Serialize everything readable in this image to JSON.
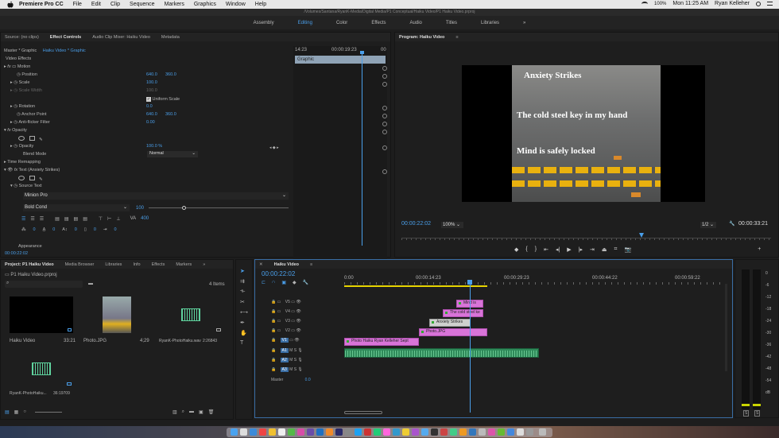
{
  "menubar": {
    "app": "Premiere Pro CC",
    "items": [
      "File",
      "Edit",
      "Clip",
      "Sequence",
      "Markers",
      "Graphics",
      "Window",
      "Help"
    ],
    "time": "Mon 11:25 AM",
    "user": "Ryan Kelleher",
    "battery": "100%"
  },
  "titlebar": {
    "path": "/Volumes/Santana/RyanK-Media/Digital Media/P1 Conceptual/Haiku Video/P1 Haiku Video.prproj"
  },
  "workspaces": {
    "items": [
      "Assembly",
      "Editing",
      "Color",
      "Effects",
      "Audio",
      "Titles",
      "Libraries"
    ],
    "active": "Editing",
    "more": "»"
  },
  "effect_controls": {
    "tabs": [
      "Source: (no clips)",
      "Effect Controls",
      "Audio Clip Mixer: Haiku Video",
      "Metadata"
    ],
    "active_tab": "Effect Controls",
    "clip_label": "Master * Graphic",
    "clip_target": "Haiku Video * Graphic",
    "section": "Video Effects",
    "mini_time_start": "14:23",
    "mini_time_mid": "00:00:19:23",
    "mini_time_end": "00",
    "graphic_label": "Graphic",
    "motion": "Motion",
    "position": "Position",
    "pos_x": "640.0",
    "pos_y": "360.0",
    "scale": "Scale",
    "scale_val": "100.0",
    "scale_width": "Scale Width",
    "scale_width_val": "100.0",
    "uniform_scale": "Uniform Scale",
    "rotation": "Rotation",
    "rotation_val": "0.0",
    "anchor": "Anchor Point",
    "anchor_x": "640.0",
    "anchor_y": "360.0",
    "flicker": "Anti-flicker Filter",
    "flicker_val": "0.00",
    "opacity_section": "Opacity",
    "opacity": "Opacity",
    "opacity_val": "100.0 %",
    "blend": "Blend Mode",
    "blend_val": "Normal",
    "time_remap": "Time Remapping",
    "text_layer": "Text (Anxiety Strikes)",
    "source_text": "Source Text",
    "font": "Minion Pro",
    "style": "Bold Cond",
    "size": "100",
    "tracking_val": "400",
    "zero1": "0",
    "zero2": "0",
    "zero3": "0",
    "zero4": "0",
    "zero5": "0",
    "appearance": "Appearance",
    "timecode": "00:00:22:02"
  },
  "program": {
    "title": "Program: Haiku Video",
    "lines": [
      "Anxiety Strikes",
      "The cold steel key in my hand",
      "Mind is safely locked"
    ],
    "timecode": "00:00:22:02",
    "zoom": "100%",
    "quality": "1/2",
    "duration": "00:00:33:21"
  },
  "project": {
    "tabs": [
      "Project: P1 Haiku Video",
      "Media Browser",
      "Libraries",
      "Info",
      "Effects",
      "Markers"
    ],
    "file": "P1 Haiku Video.prproj",
    "count": "4 Items",
    "items": [
      {
        "name": "Haiku Video",
        "dur": "33:21"
      },
      {
        "name": "Photo.JPG",
        "dur": "4;29"
      },
      {
        "name": "RyanK-PhotoHaiku.wav",
        "dur": "2:26843"
      },
      {
        "name": "RyanK-PhotoHaiku...",
        "dur": "36:19709"
      }
    ]
  },
  "timeline": {
    "title": "Haiku Video",
    "timecode": "00:00:22:02",
    "ruler": [
      "0:00",
      "00:00:14:23",
      "00:00:29:23",
      "00:00:44:22",
      "00:00:59:22"
    ],
    "tracks": [
      "V5",
      "V4",
      "V3",
      "V2",
      "V1",
      "A1",
      "A2",
      "A3"
    ],
    "master": "Master",
    "master_val": "0.0",
    "clips": [
      {
        "label": "Mind is"
      },
      {
        "label": "The cold steel ke"
      },
      {
        "label": "Anxiety Strikes"
      },
      {
        "label": "Photo.JPG"
      },
      {
        "label": "Photo Haiku Ryan Kelleher Sept"
      }
    ]
  },
  "meter": {
    "labels": [
      "0",
      "-6",
      "-12",
      "-18",
      "-24",
      "-30",
      "-36",
      "-42",
      "-48",
      "-54",
      "dB"
    ],
    "solo": [
      "S",
      "S"
    ]
  }
}
